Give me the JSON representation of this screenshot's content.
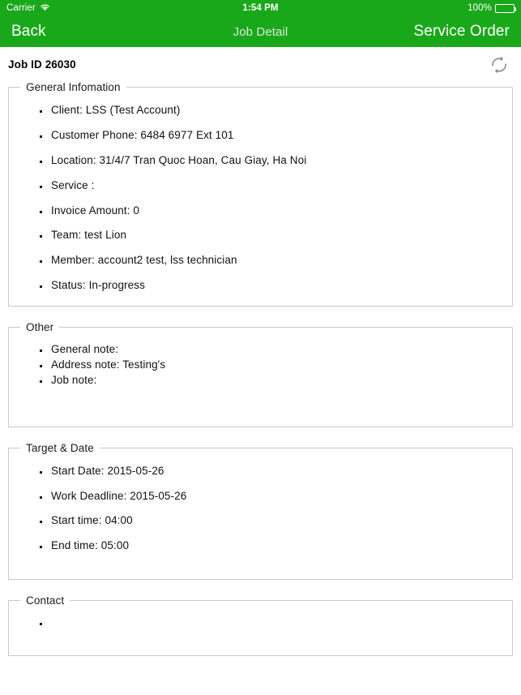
{
  "status_bar": {
    "carrier": "Carrier",
    "wifi_icon": "wifi-icon",
    "time": "1:54 PM",
    "battery_percent": "100%",
    "battery_icon": "battery-full-icon"
  },
  "nav_bar": {
    "back_label": "Back",
    "title": "Job Detail",
    "right_label": "Service Order",
    "bar_color": "#1AA81B",
    "title_color": "#d8ead8",
    "label_color": "#ffffff"
  },
  "page_header": {
    "job_id": "Job ID 26030",
    "refresh_icon": "refresh-icon"
  },
  "sections": [
    {
      "legend": "General Infomation",
      "items": [
        "Client: LSS (Test Account)",
        "Customer Phone: 6484 6977 Ext 101",
        "Location: 31/4/7 Tran Quoc Hoan, Cau Giay, Ha Noi",
        "Service :",
        "Invoice Amount: 0",
        "Team: test Lion",
        "Member: account2 test, lss technician",
        "Status: In-progress"
      ]
    },
    {
      "legend": "Other",
      "items": [
        "General note:",
        "Address note: Testing's",
        "Job note:"
      ]
    },
    {
      "legend": "Target & Date",
      "items": [
        "Start Date: 2015-05-26",
        "Work Deadline: 2015-05-26",
        "Start time: 04:00",
        "End time: 05:00"
      ]
    },
    {
      "legend": "Contact",
      "items": [
        ""
      ]
    }
  ],
  "colors": {
    "brand_green": "#1AA81B",
    "panel_border": "#c9c9c9",
    "text": "#111111"
  }
}
